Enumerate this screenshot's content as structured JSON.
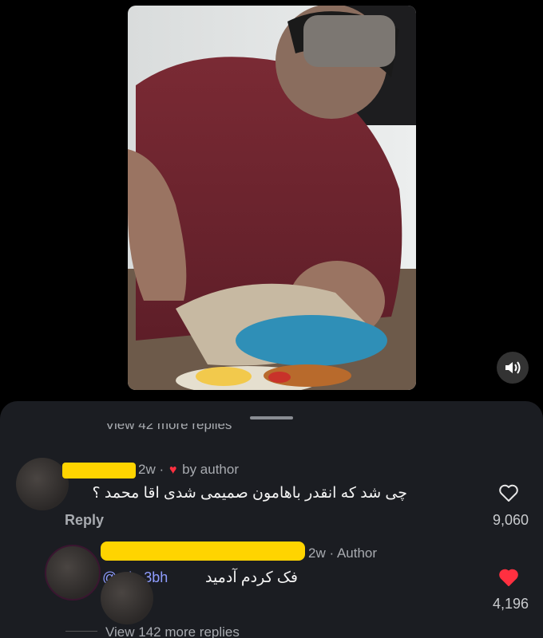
{
  "video": {
    "mute_icon": "volume-icon"
  },
  "comments": {
    "view_more_top": "View 42 more replies",
    "items": [
      {
        "time": "2w",
        "separator": "·",
        "liked_by": "by author",
        "text": "چی شد که انقدر باهامون صمیمی شدی اقا محمد ؟",
        "reply_label": "Reply",
        "likes": "9,060",
        "liked": false
      },
      {
        "time": "2w",
        "separator": "·",
        "author_badge": "Author",
        "mention": "@...in.3bh",
        "text": "فک کردم آدمید",
        "likes": "4,196",
        "liked": true
      }
    ],
    "view_more_bottom": "View 142 more replies"
  },
  "colors": {
    "sheet_bg": "#1b1d22",
    "accent_red": "#ff3040",
    "mention_blue": "#8f9dff",
    "redaction_yellow": "#ffd400"
  }
}
